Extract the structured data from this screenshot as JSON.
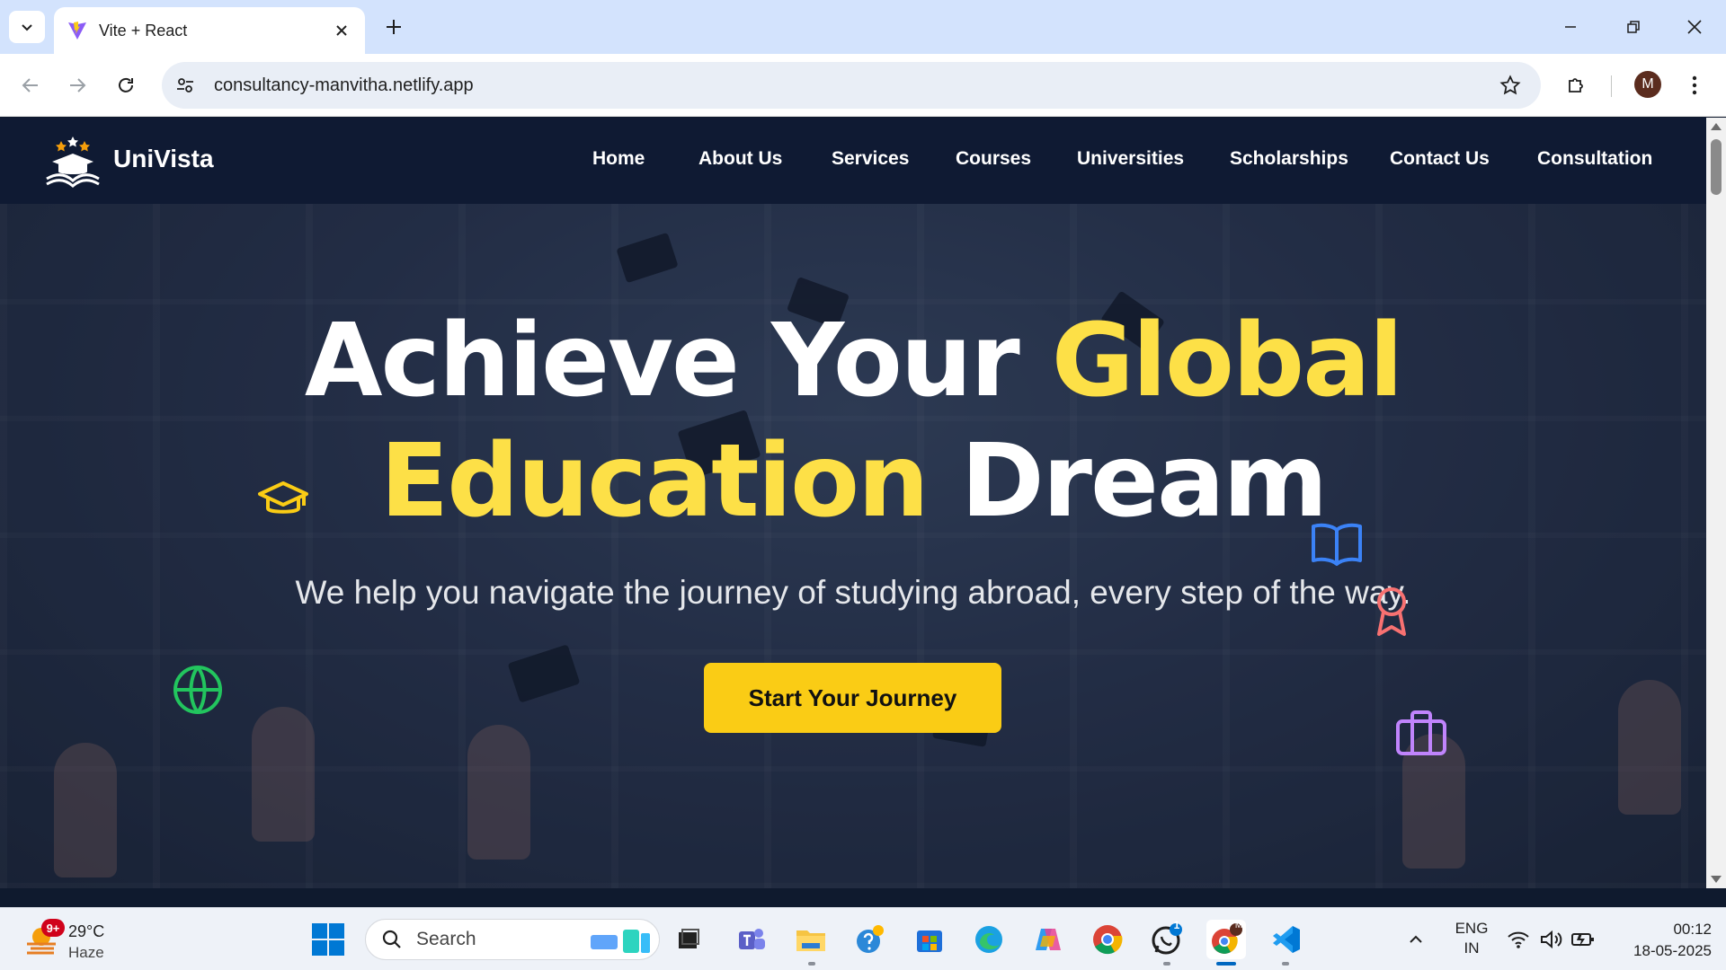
{
  "browser": {
    "tab_title": "Vite + React",
    "url": "consultancy-manvitha.netlify.app",
    "profile_initial": "M"
  },
  "site": {
    "brand": "UniVista",
    "nav": [
      "Home",
      "About Us",
      "Services",
      "Courses",
      "Universities",
      "Scholarships",
      "Contact Us",
      "Consultation"
    ]
  },
  "hero": {
    "title_part1": "Achieve Your ",
    "title_highlight1": "Global",
    "title_highlight2": "Education",
    "title_part2": " Dream",
    "subtitle": "We help you navigate the journey of studying abroad, every step of the way.",
    "cta": "Start Your Journey"
  },
  "colors": {
    "accent": "#facc15",
    "highlight_text": "#fde047",
    "nav_bg": "#0f1a33",
    "icon_green": "#22c55e",
    "icon_blue": "#3b82f6",
    "icon_red": "#f87171",
    "icon_purple": "#c084fc"
  },
  "taskbar": {
    "weather_badge": "9+",
    "temperature": "29°C",
    "condition": "Haze",
    "search_placeholder": "Search",
    "whatsapp_badge": "1",
    "chrome_profile_badge": "M",
    "language_line1": "ENG",
    "language_line2": "IN",
    "time": "00:12",
    "date": "18-05-2025"
  }
}
